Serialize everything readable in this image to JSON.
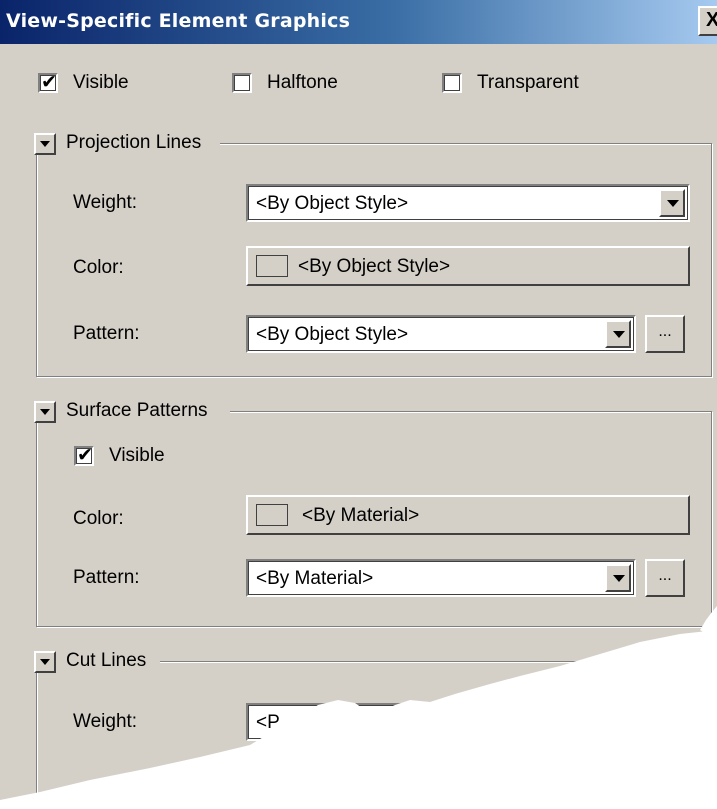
{
  "dialog": {
    "title": "View-Specific Element Graphics",
    "close_glyph": "X"
  },
  "visibility": {
    "visible": {
      "label": "Visible",
      "checked": true
    },
    "halftone": {
      "label": "Halftone",
      "checked": false
    },
    "transparent": {
      "label": "Transparent",
      "checked": false
    }
  },
  "projection_lines": {
    "header": "Projection Lines",
    "weight_label": "Weight:",
    "weight_value": "<By Object Style>",
    "color_label": "Color:",
    "color_value": "<By Object Style>",
    "pattern_label": "Pattern:",
    "pattern_value": "<By Object Style>",
    "pattern_more": "..."
  },
  "surface_patterns": {
    "header": "Surface Patterns",
    "visible_label": "Visible",
    "visible_checked": true,
    "color_label": "Color:",
    "color_value": "<By Material>",
    "pattern_label": "Pattern:",
    "pattern_value": "<By Material>",
    "pattern_more": "..."
  },
  "cut_lines": {
    "header": "Cut Lines",
    "weight_label": "Weight:",
    "weight_value_partial": "<P"
  },
  "check_glyph": "✔",
  "colors": {
    "dialog_bg": "#d4d0c8",
    "title_gradient_start": "#0a246a",
    "title_gradient_end": "#a6caf0"
  }
}
